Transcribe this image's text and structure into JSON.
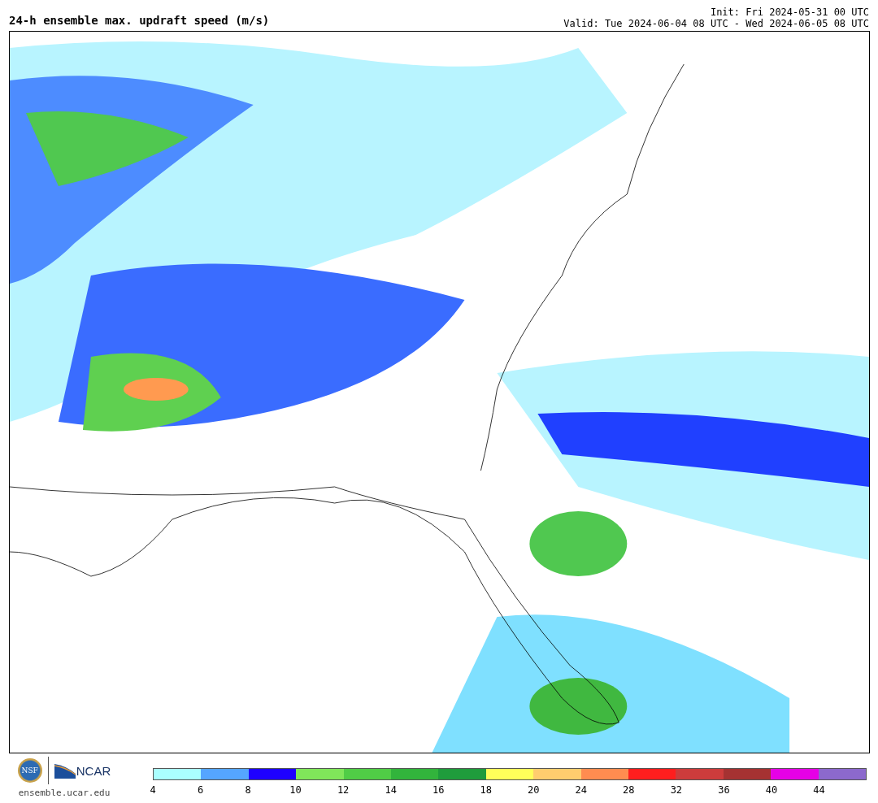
{
  "title": "24-h ensemble max. updraft speed (m/s)",
  "init": "Init: Fri 2024-05-31 00 UTC",
  "valid": "Valid: Tue 2024-06-04 08 UTC - Wed 2024-06-05 08 UTC",
  "logos": {
    "seal_text": "NSF",
    "wordmark": "NCAR",
    "site": "ensemble.ucar.edu"
  },
  "colorbar": {
    "bins": [
      {
        "color": "#aaffff",
        "tick": "4"
      },
      {
        "color": "#55a5ff",
        "tick": "6"
      },
      {
        "color": "#1e00ff",
        "tick": "8"
      },
      {
        "color": "#80e65a",
        "tick": "10"
      },
      {
        "color": "#50cd46",
        "tick": "12"
      },
      {
        "color": "#32b43c",
        "tick": "14"
      },
      {
        "color": "#1f9c3c",
        "tick": "16"
      },
      {
        "color": "#ffff5a",
        "tick": "18"
      },
      {
        "color": "#ffcd6e",
        "tick": "20"
      },
      {
        "color": "#ff8c50",
        "tick": "24"
      },
      {
        "color": "#ff1e1e",
        "tick": "28"
      },
      {
        "color": "#cd3c3c",
        "tick": "32"
      },
      {
        "color": "#a53232",
        "tick": "36"
      },
      {
        "color": "#e600e6",
        "tick": "40"
      },
      {
        "color": "#8c69cd",
        "tick": "44"
      }
    ]
  }
}
